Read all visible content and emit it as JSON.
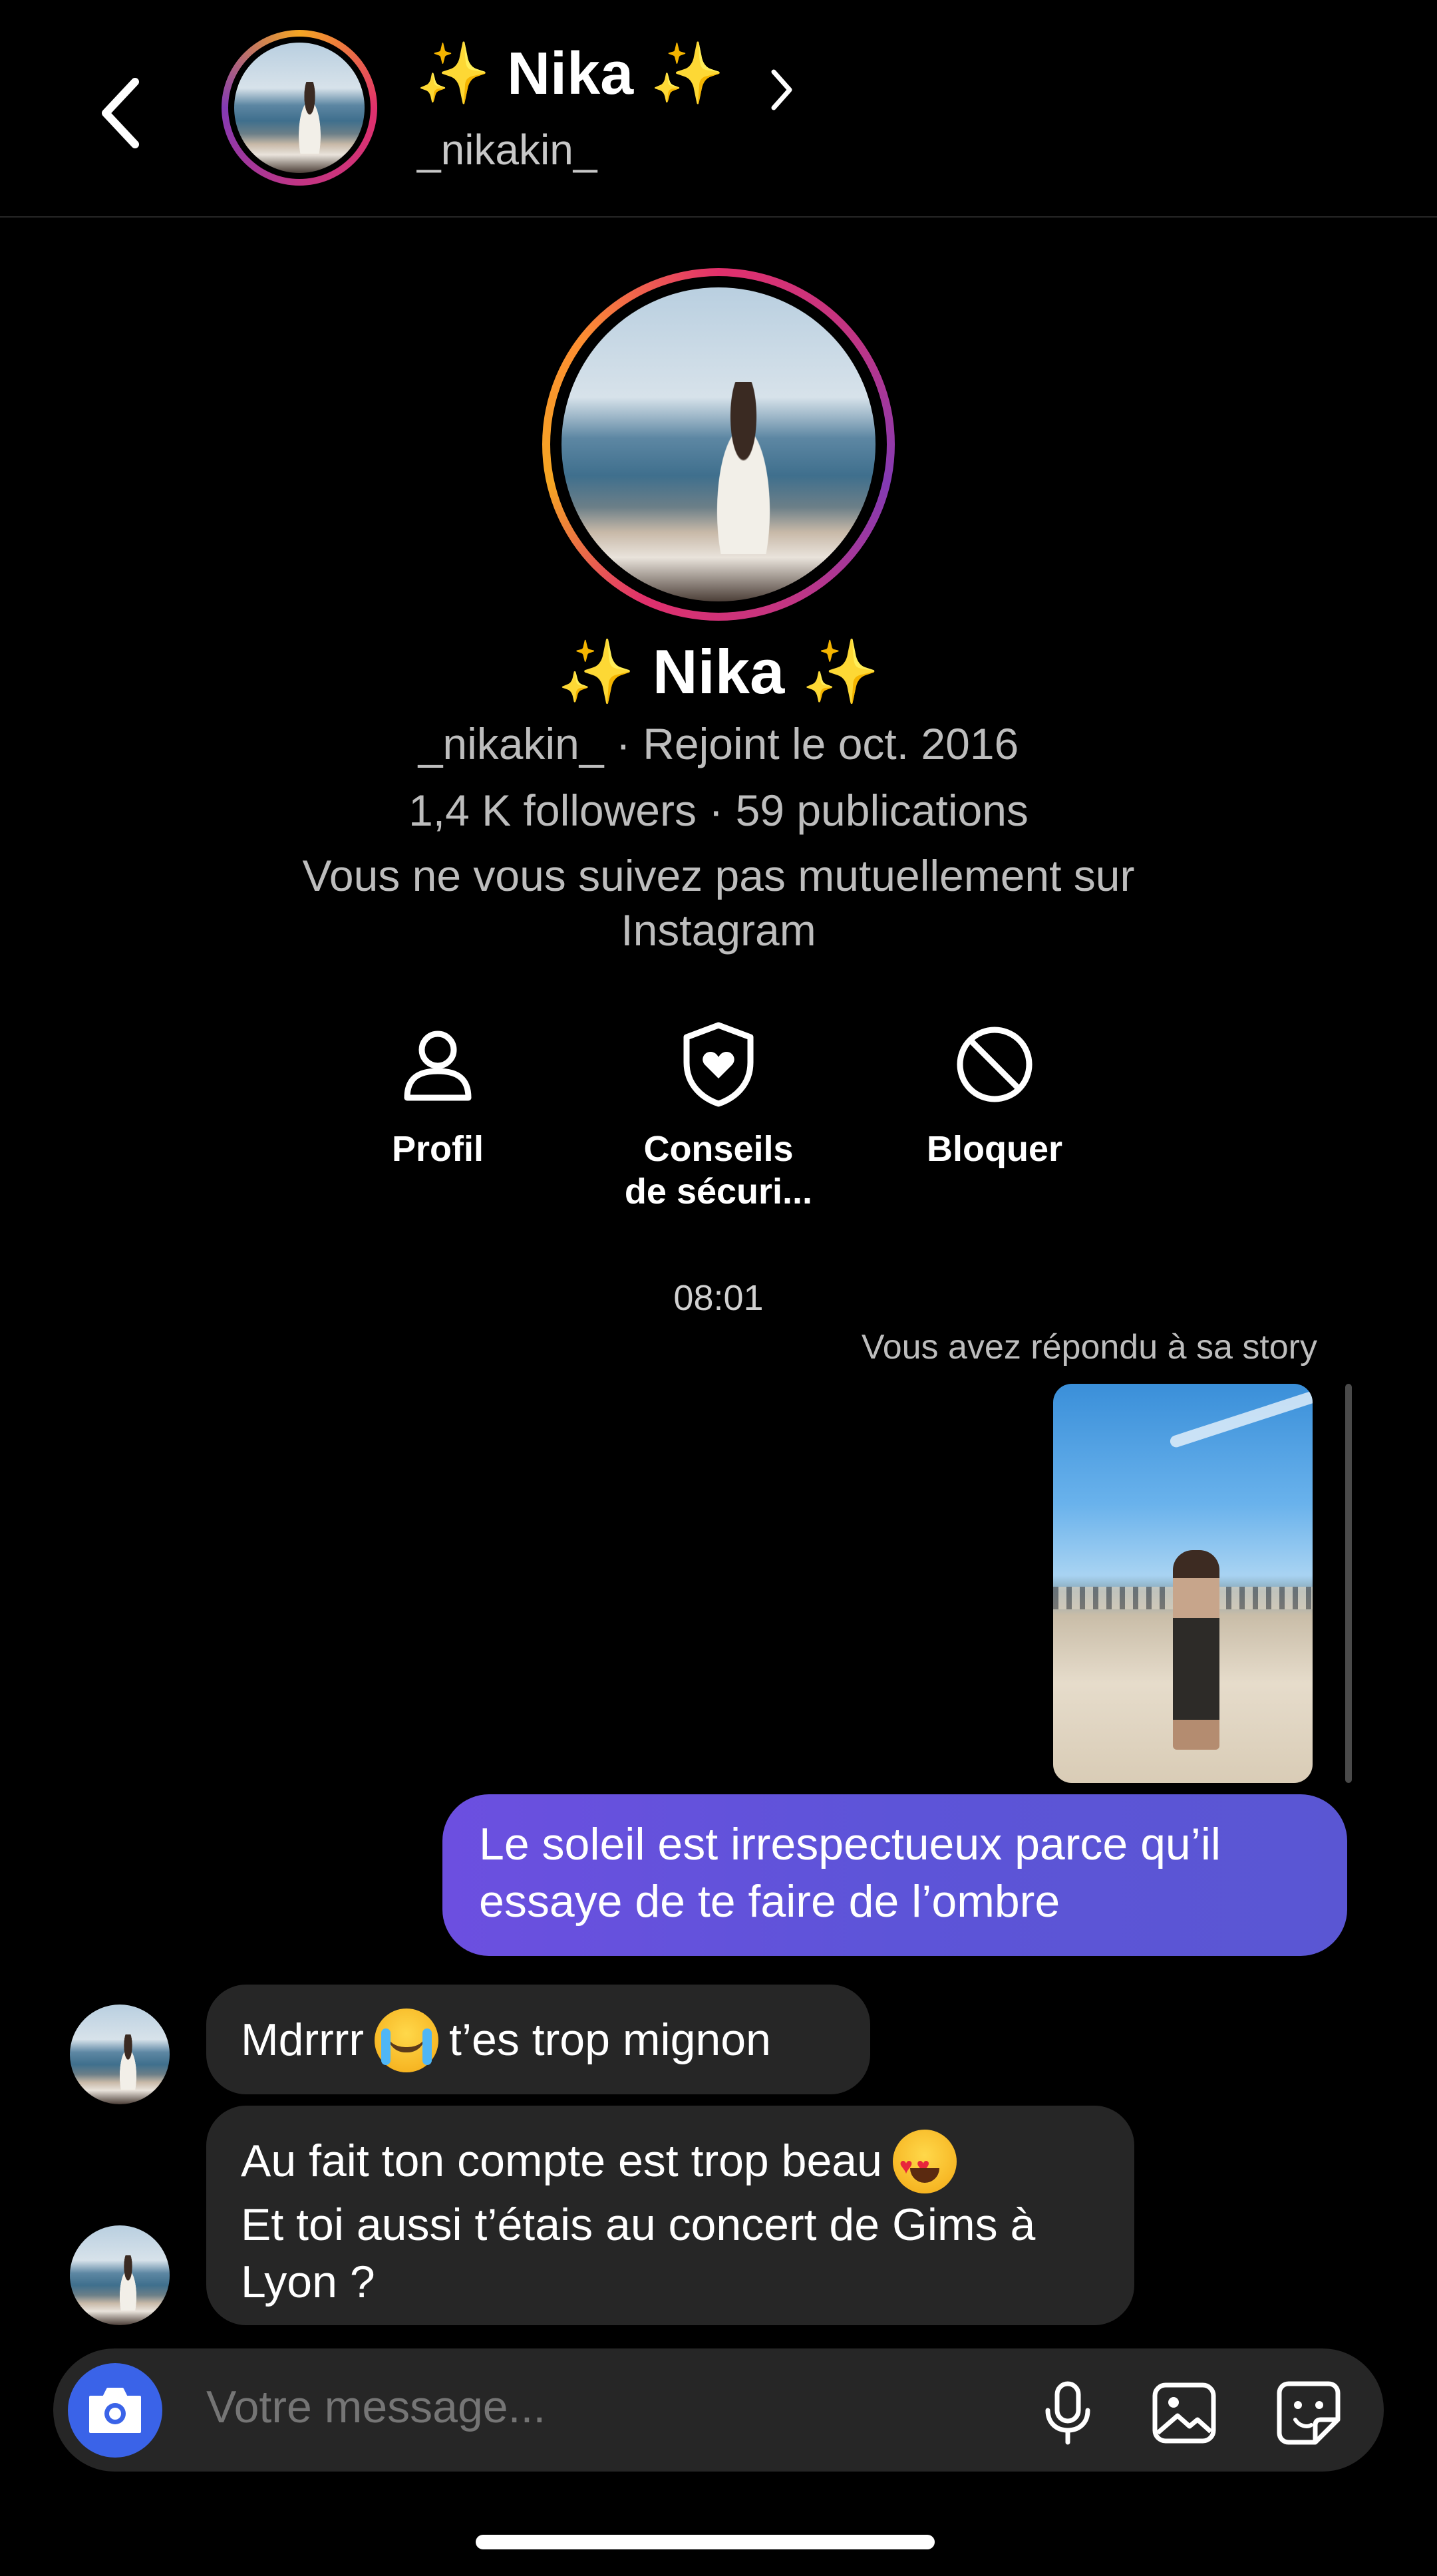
{
  "header": {
    "name": "✨ Nika ✨",
    "username": "_nikakin_"
  },
  "profile": {
    "name": "✨ Nika ✨",
    "meta": "_nikakin_ · Rejoint le oct. 2016",
    "stats": "1,4 K followers · 59 publications",
    "mutual": "Vous ne vous suivez pas mutuellement sur Instagram"
  },
  "actions": [
    {
      "label": "Profil",
      "icon": "person-icon"
    },
    {
      "label": "Conseils de sécuri...",
      "icon": "shield-heart-icon"
    },
    {
      "label": "Bloquer",
      "icon": "block-icon"
    }
  ],
  "thread": {
    "timestamp": "08:01",
    "story_note": "Vous avez répondu à sa story",
    "outgoing": "Le soleil est irrespectueux parce qu’il essaye de te faire de l’ombre",
    "incoming_1_a": "Mdrrrr",
    "incoming_1_b": "t’es trop mignon",
    "incoming_2_line1": "Au fait ton compte est trop beau",
    "incoming_2_rest": "Et toi aussi t’étais au concert de Gims à Lyon ?"
  },
  "composer": {
    "placeholder": "Votre message..."
  },
  "colors": {
    "outgoing_bubble": "#5d54d8",
    "incoming_bubble": "#262626",
    "camera_button": "#3a63e8"
  }
}
